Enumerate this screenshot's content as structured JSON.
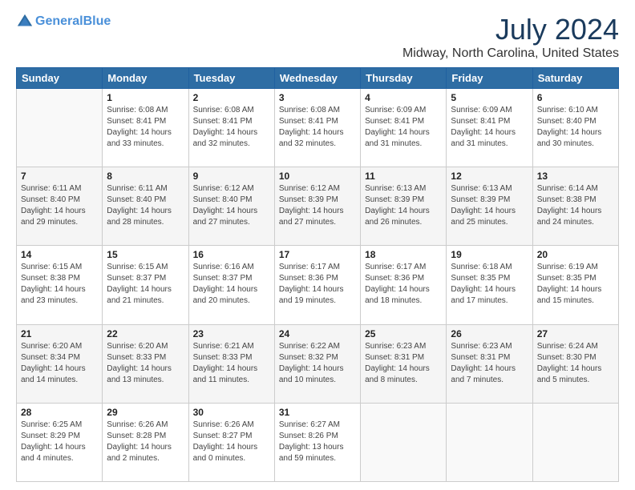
{
  "header": {
    "logo_line1": "General",
    "logo_line2": "Blue",
    "title": "July 2024",
    "subtitle": "Midway, North Carolina, United States"
  },
  "weekdays": [
    "Sunday",
    "Monday",
    "Tuesday",
    "Wednesday",
    "Thursday",
    "Friday",
    "Saturday"
  ],
  "weeks": [
    [
      {
        "day": "",
        "info": ""
      },
      {
        "day": "1",
        "info": "Sunrise: 6:08 AM\nSunset: 8:41 PM\nDaylight: 14 hours\nand 33 minutes."
      },
      {
        "day": "2",
        "info": "Sunrise: 6:08 AM\nSunset: 8:41 PM\nDaylight: 14 hours\nand 32 minutes."
      },
      {
        "day": "3",
        "info": "Sunrise: 6:08 AM\nSunset: 8:41 PM\nDaylight: 14 hours\nand 32 minutes."
      },
      {
        "day": "4",
        "info": "Sunrise: 6:09 AM\nSunset: 8:41 PM\nDaylight: 14 hours\nand 31 minutes."
      },
      {
        "day": "5",
        "info": "Sunrise: 6:09 AM\nSunset: 8:41 PM\nDaylight: 14 hours\nand 31 minutes."
      },
      {
        "day": "6",
        "info": "Sunrise: 6:10 AM\nSunset: 8:40 PM\nDaylight: 14 hours\nand 30 minutes."
      }
    ],
    [
      {
        "day": "7",
        "info": "Sunrise: 6:11 AM\nSunset: 8:40 PM\nDaylight: 14 hours\nand 29 minutes."
      },
      {
        "day": "8",
        "info": "Sunrise: 6:11 AM\nSunset: 8:40 PM\nDaylight: 14 hours\nand 28 minutes."
      },
      {
        "day": "9",
        "info": "Sunrise: 6:12 AM\nSunset: 8:40 PM\nDaylight: 14 hours\nand 27 minutes."
      },
      {
        "day": "10",
        "info": "Sunrise: 6:12 AM\nSunset: 8:39 PM\nDaylight: 14 hours\nand 27 minutes."
      },
      {
        "day": "11",
        "info": "Sunrise: 6:13 AM\nSunset: 8:39 PM\nDaylight: 14 hours\nand 26 minutes."
      },
      {
        "day": "12",
        "info": "Sunrise: 6:13 AM\nSunset: 8:39 PM\nDaylight: 14 hours\nand 25 minutes."
      },
      {
        "day": "13",
        "info": "Sunrise: 6:14 AM\nSunset: 8:38 PM\nDaylight: 14 hours\nand 24 minutes."
      }
    ],
    [
      {
        "day": "14",
        "info": "Sunrise: 6:15 AM\nSunset: 8:38 PM\nDaylight: 14 hours\nand 23 minutes."
      },
      {
        "day": "15",
        "info": "Sunrise: 6:15 AM\nSunset: 8:37 PM\nDaylight: 14 hours\nand 21 minutes."
      },
      {
        "day": "16",
        "info": "Sunrise: 6:16 AM\nSunset: 8:37 PM\nDaylight: 14 hours\nand 20 minutes."
      },
      {
        "day": "17",
        "info": "Sunrise: 6:17 AM\nSunset: 8:36 PM\nDaylight: 14 hours\nand 19 minutes."
      },
      {
        "day": "18",
        "info": "Sunrise: 6:17 AM\nSunset: 8:36 PM\nDaylight: 14 hours\nand 18 minutes."
      },
      {
        "day": "19",
        "info": "Sunrise: 6:18 AM\nSunset: 8:35 PM\nDaylight: 14 hours\nand 17 minutes."
      },
      {
        "day": "20",
        "info": "Sunrise: 6:19 AM\nSunset: 8:35 PM\nDaylight: 14 hours\nand 15 minutes."
      }
    ],
    [
      {
        "day": "21",
        "info": "Sunrise: 6:20 AM\nSunset: 8:34 PM\nDaylight: 14 hours\nand 14 minutes."
      },
      {
        "day": "22",
        "info": "Sunrise: 6:20 AM\nSunset: 8:33 PM\nDaylight: 14 hours\nand 13 minutes."
      },
      {
        "day": "23",
        "info": "Sunrise: 6:21 AM\nSunset: 8:33 PM\nDaylight: 14 hours\nand 11 minutes."
      },
      {
        "day": "24",
        "info": "Sunrise: 6:22 AM\nSunset: 8:32 PM\nDaylight: 14 hours\nand 10 minutes."
      },
      {
        "day": "25",
        "info": "Sunrise: 6:23 AM\nSunset: 8:31 PM\nDaylight: 14 hours\nand 8 minutes."
      },
      {
        "day": "26",
        "info": "Sunrise: 6:23 AM\nSunset: 8:31 PM\nDaylight: 14 hours\nand 7 minutes."
      },
      {
        "day": "27",
        "info": "Sunrise: 6:24 AM\nSunset: 8:30 PM\nDaylight: 14 hours\nand 5 minutes."
      }
    ],
    [
      {
        "day": "28",
        "info": "Sunrise: 6:25 AM\nSunset: 8:29 PM\nDaylight: 14 hours\nand 4 minutes."
      },
      {
        "day": "29",
        "info": "Sunrise: 6:26 AM\nSunset: 8:28 PM\nDaylight: 14 hours\nand 2 minutes."
      },
      {
        "day": "30",
        "info": "Sunrise: 6:26 AM\nSunset: 8:27 PM\nDaylight: 14 hours\nand 0 minutes."
      },
      {
        "day": "31",
        "info": "Sunrise: 6:27 AM\nSunset: 8:26 PM\nDaylight: 13 hours\nand 59 minutes."
      },
      {
        "day": "",
        "info": ""
      },
      {
        "day": "",
        "info": ""
      },
      {
        "day": "",
        "info": ""
      }
    ]
  ]
}
